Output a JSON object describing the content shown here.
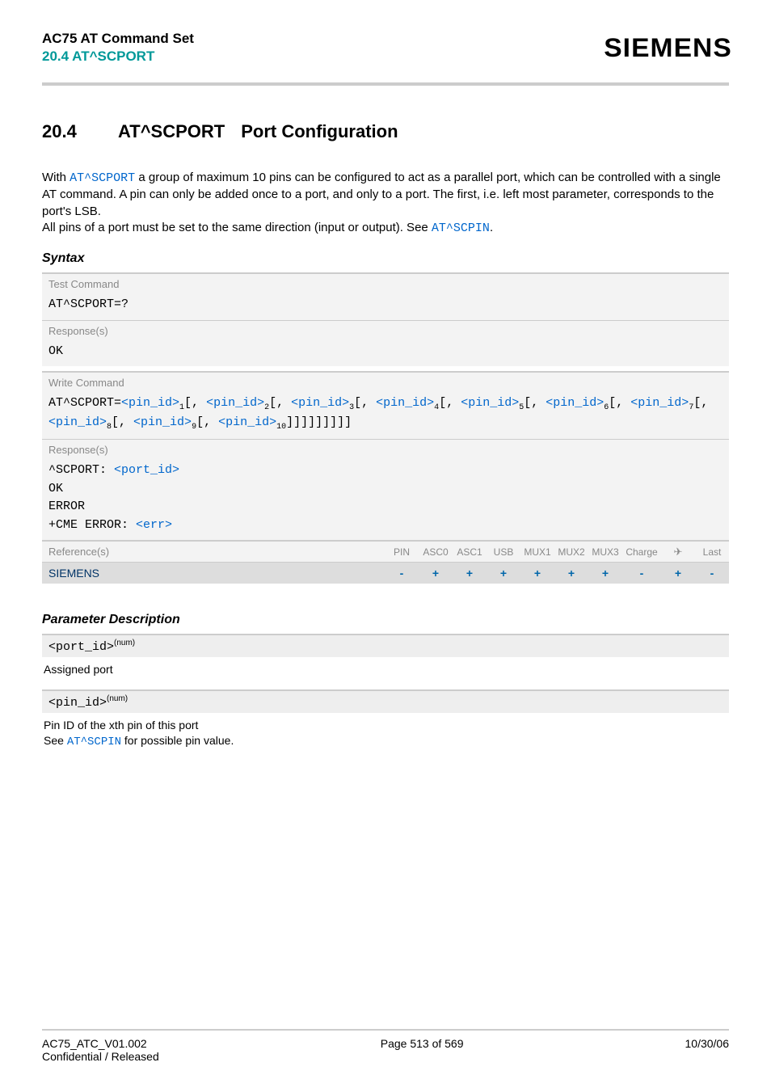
{
  "header": {
    "doc_title": "AC75 AT Command Set",
    "doc_sub": "20.4 AT^SCPORT",
    "logo": "SIEMENS"
  },
  "section": {
    "number": "20.4",
    "cmd": "AT^SCPORT",
    "title": "Port Configuration"
  },
  "intro": {
    "p1_pre": "With ",
    "p1_cmd": "AT^SCPORT",
    "p1_post": " a group of maximum 10 pins can be configured to act as a parallel port, which can be controlled with a single AT command. A pin can only be added once to a port, and only to a port. The first, i.e. left most parameter, corresponds to the port's LSB.",
    "p2_pre": "All pins of a port must be set to the same direction (input or output). See ",
    "p2_cmd": "AT^SCPIN",
    "p2_post": "."
  },
  "syntax_label": "Syntax",
  "test_cmd": {
    "label": "Test Command",
    "cmd": "AT^SCPORT=?",
    "resp_label": "Response(s)",
    "resp": "OK"
  },
  "write_cmd": {
    "label": "Write Command",
    "prefix": "AT^SCPORT=",
    "pin_label": "<pin_id>",
    "suffix": "]]]]]]]]]",
    "resp_label": "Response(s)",
    "resp_prefix": "^SCPORT: ",
    "resp_port": "<port_id>",
    "ok": "OK",
    "error": "ERROR",
    "cme_pre": "+CME ERROR: ",
    "cme_err": "<err>"
  },
  "ref": {
    "label": "Reference(s)",
    "cols": [
      "PIN",
      "ASC0",
      "ASC1",
      "USB",
      "MUX1",
      "MUX2",
      "MUX3",
      "Charge",
      "✈",
      "Last"
    ],
    "brand": "SIEMENS",
    "vals": [
      "-",
      "+",
      "+",
      "+",
      "+",
      "+",
      "+",
      "-",
      "+",
      "-"
    ]
  },
  "params": {
    "heading": "Parameter Description",
    "port": {
      "name": "<port_id>",
      "sup": "(num)",
      "desc": "Assigned port"
    },
    "pin": {
      "name": "<pin_id>",
      "sup": "(num)",
      "desc1": "Pin ID of the xth pin of this port",
      "desc2_pre": "See ",
      "desc2_cmd": "AT^SCPIN",
      "desc2_post": " for possible pin value."
    }
  },
  "footer": {
    "left1": "AC75_ATC_V01.002",
    "left2": "Confidential / Released",
    "mid": "Page 513 of 569",
    "right": "10/30/06"
  }
}
